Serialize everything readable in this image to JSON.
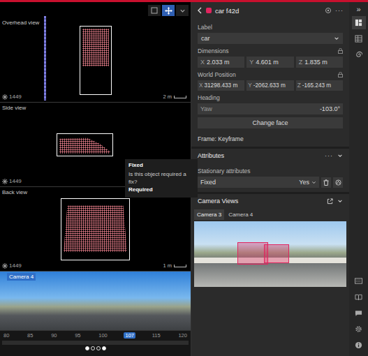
{
  "toolbar": [
    {
      "selected": false
    },
    {
      "selected": true
    },
    {
      "selected": false
    }
  ],
  "views": [
    {
      "title": "Overhead view",
      "frame": "1449",
      "scale": "2 m"
    },
    {
      "title": "Side view",
      "frame": "1449"
    },
    {
      "title": "Back view",
      "frame": "1449",
      "scale": "1 m"
    }
  ],
  "camera_strip": {
    "title": "Camera 4"
  },
  "timeline": {
    "ticks": [
      {
        "label": "80",
        "selected": false
      },
      {
        "label": "85",
        "selected": false
      },
      {
        "label": "90",
        "selected": false
      },
      {
        "label": "95",
        "selected": false
      },
      {
        "label": "100",
        "selected": false
      },
      {
        "label": "107",
        "selected": true
      },
      {
        "label": "115",
        "selected": false
      },
      {
        "label": "120",
        "selected": false
      }
    ],
    "dots": [
      {
        "selected": true
      },
      {
        "selected": false
      },
      {
        "selected": false
      },
      {
        "selected": true
      }
    ]
  },
  "tooltip": {
    "title": "Fixed",
    "text": "Is this object required a fix?",
    "value": "Required"
  },
  "panel": {
    "color": "#e0245e",
    "title": "car f42d",
    "menu": "···",
    "label": {
      "heading": "Label",
      "value": "car"
    },
    "dimensions": {
      "heading": "Dimensions",
      "fields": [
        {
          "axis": "X",
          "value": "2.033 m"
        },
        {
          "axis": "Y",
          "value": "4.601 m"
        },
        {
          "axis": "Z",
          "value": "1.835 m"
        }
      ]
    },
    "world_position": {
      "heading": "World Position",
      "fields": [
        {
          "axis": "X",
          "value": "31298.433 m"
        },
        {
          "axis": "Y",
          "value": "-2062.633 m"
        },
        {
          "axis": "Z",
          "value": "-165.243 m"
        }
      ]
    },
    "heading": {
      "heading": "Heading",
      "axis": "Yaw",
      "value": "-103.0°",
      "button": "Change face"
    },
    "frame": "Frame: Keyframe",
    "attributes": {
      "title": "Attributes",
      "menu": "···",
      "expanded": true,
      "group": "Stationary attributes",
      "items": [
        {
          "name": "Fixed",
          "value": "Yes"
        }
      ]
    },
    "camera_views": {
      "title": "Camera Views",
      "expanded": true,
      "tabs": [
        {
          "label": "Camera 3",
          "selected": true
        },
        {
          "label": "Camera 4",
          "selected": false
        }
      ]
    }
  },
  "rail": {
    "collapse": "»",
    "top": [
      {
        "selected": true
      },
      {
        "selected": false
      },
      {
        "selected": false
      }
    ],
    "bottom": [
      {
        "selected": false
      },
      {
        "selected": false
      },
      {
        "selected": false
      },
      {
        "selected": false
      },
      {
        "selected": false
      }
    ]
  }
}
